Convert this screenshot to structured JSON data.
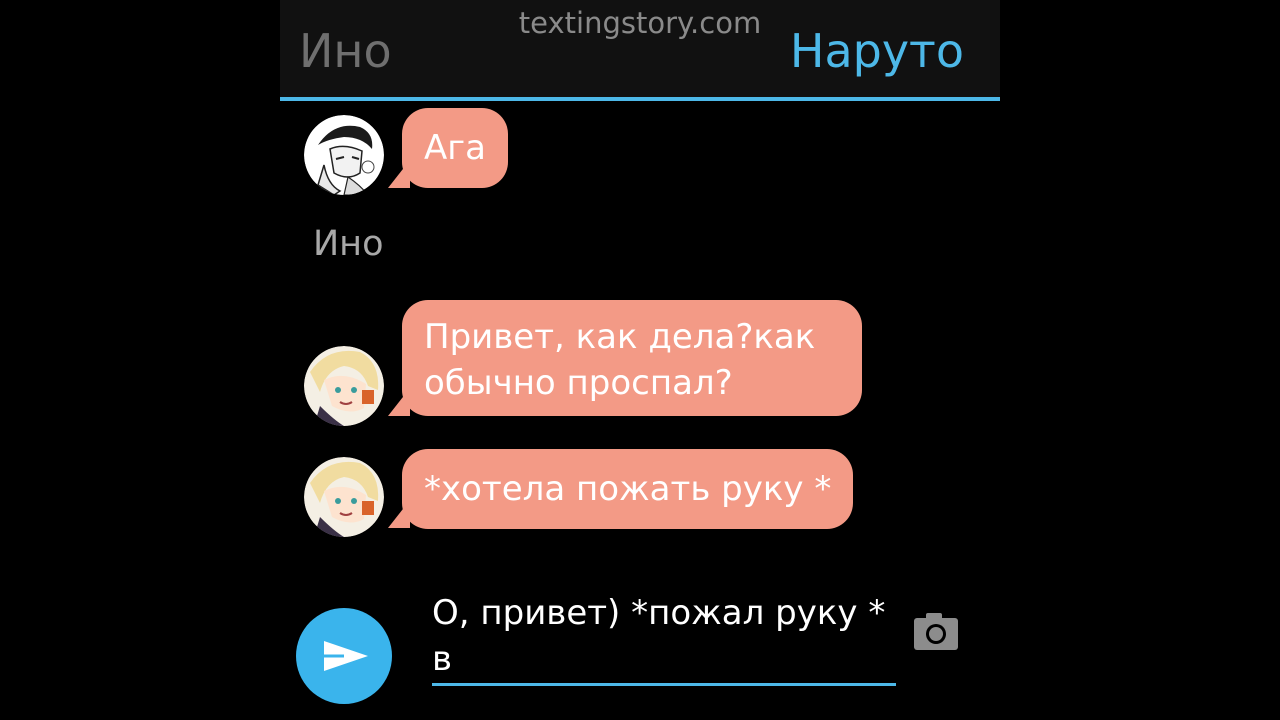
{
  "header": {
    "watermark": "textingstory.com",
    "left_contact": "Ино",
    "right_contact": "Наруто"
  },
  "messages": [
    {
      "text": "Ага",
      "avatar": "shikamaru-avatar"
    },
    {
      "text": "Привет, как дела?как\nобычно проспал?",
      "avatar": "ino-avatar"
    },
    {
      "text": "*хотела пожать руку *",
      "avatar": "ino-avatar"
    }
  ],
  "sender_label": "Ино",
  "composer": {
    "value": "О, привет) *пожал руку *\nв",
    "send_icon": "send-icon",
    "camera_icon": "camera-icon"
  },
  "colors": {
    "accent": "#4db8e8",
    "bubble": "#f39a86",
    "background": "#000000"
  }
}
